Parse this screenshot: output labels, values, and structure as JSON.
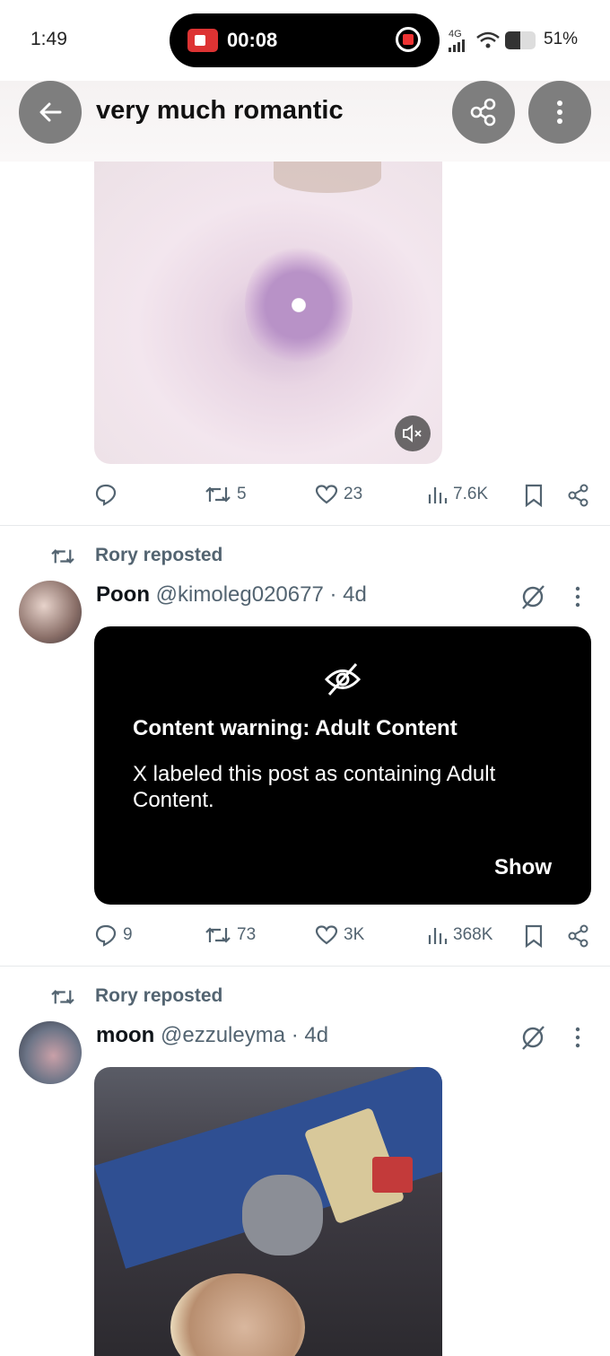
{
  "status_bar": {
    "time": "1:49",
    "recording_time": "00:08",
    "network": "4G",
    "battery_percent": "51%",
    "battery_level": 0.51
  },
  "header": {
    "title": "very much romantic",
    "back_icon": "back-arrow-icon",
    "share_icon": "share-icon",
    "more_icon": "more-vertical-icon"
  },
  "post1": {
    "actions": {
      "reply": "",
      "reposts": "5",
      "likes": "23",
      "views": "7.6K"
    }
  },
  "post2": {
    "repost_label": "Rory reposted",
    "name": "Poon",
    "handle": "@kimoleg020677",
    "time": "· 4d",
    "warning": {
      "title": "Content warning: Adult Content",
      "text": "X labeled this post as containing Adult Content.",
      "show": "Show"
    },
    "actions": {
      "reply": "9",
      "reposts": "73",
      "likes": "3K",
      "views": "368K"
    }
  },
  "post3": {
    "repost_label": "Rory reposted",
    "name": "moon",
    "handle": "@ezzuleyma",
    "time": "· 4d"
  },
  "colors": {
    "accent_gray": "#536471",
    "header_button": "#7e7e7e",
    "rec_red": "#dd3333"
  }
}
